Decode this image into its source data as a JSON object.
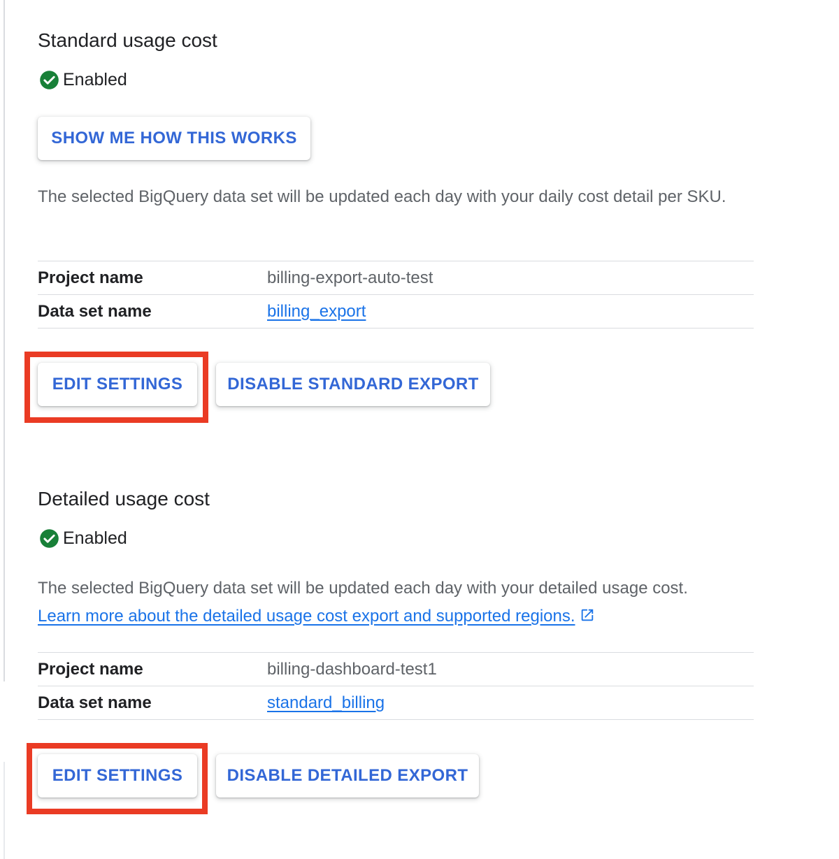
{
  "standard": {
    "title": "Standard usage cost",
    "status": "Enabled",
    "show_how_button": "SHOW ME HOW THIS WORKS",
    "description": "The selected BigQuery data set will be updated each day with your daily cost detail per SKU.",
    "rows": [
      {
        "key": "Project name",
        "value": "billing-export-auto-test"
      },
      {
        "key": "Data set name",
        "value": "billing_export"
      }
    ],
    "edit_button": "EDIT SETTINGS",
    "disable_button": "DISABLE STANDARD EXPORT"
  },
  "detailed": {
    "title": "Detailed usage cost",
    "status": "Enabled",
    "description": "The selected BigQuery data set will be updated each day with your detailed usage cost.",
    "learn_more_link": "Learn more about the detailed usage cost export and supported regions.",
    "rows": [
      {
        "key": "Project name",
        "value": "billing-dashboard-test1"
      },
      {
        "key": "Data set name",
        "value": "standard_billing"
      }
    ],
    "edit_button": "EDIT SETTINGS",
    "disable_button": "DISABLE DETAILED EXPORT"
  },
  "colors": {
    "accent": "#3367d6",
    "link": "#1a73e8",
    "success": "#188038",
    "highlight": "#ea3b24"
  },
  "icons": {
    "status": "check-circle-icon",
    "external_link": "open-in-new-icon"
  }
}
